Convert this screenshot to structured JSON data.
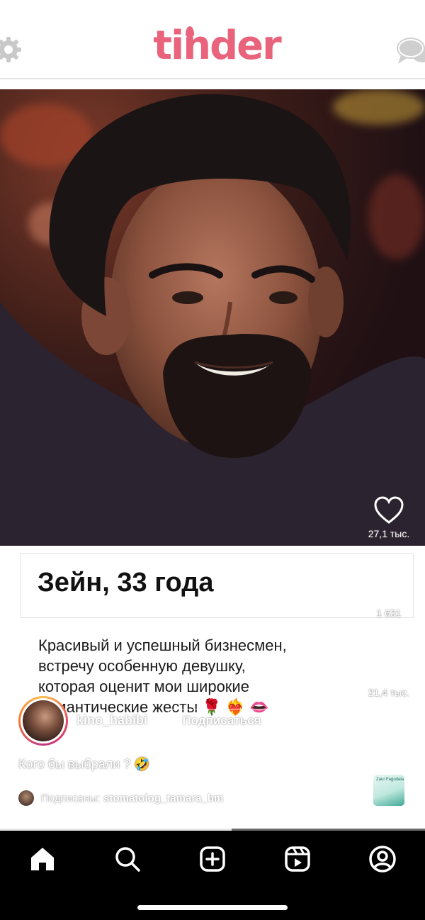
{
  "header": {
    "logo_text": "tinder",
    "brand_color": "#e8637b",
    "left_icon": "gear-icon",
    "right_icon": "chat-bubbles-icon"
  },
  "profile": {
    "name": "Зейн, 33 года",
    "bio_lines": [
      "Красивый и успешный бизнесмен,",
      "встречу особенную девушку,",
      "которая оценит мои широкие",
      "романтические жесты 🌹 ❤️‍🔥 👄"
    ]
  },
  "actions": {
    "like": {
      "icon": "heart-icon",
      "count": "27,1 тыс."
    },
    "comment": {
      "icon": "comment-icon",
      "count": "1 631"
    },
    "share": {
      "icon": "send-icon",
      "count": "21,4 тыс."
    },
    "more": {
      "icon": "more-icon"
    }
  },
  "author": {
    "username": "kino_habibi",
    "follow_label": "Подписаться"
  },
  "caption": "Кого бы выбрали ? 🤣",
  "followed_by": {
    "label": "Подписаны:",
    "account": "stomatolog_tamara_bm"
  },
  "audio_thumb_text": "Zaur Fagodala",
  "progress_fraction": 0.545,
  "nav": [
    {
      "name": "home",
      "icon": "home-icon"
    },
    {
      "name": "search",
      "icon": "search-icon"
    },
    {
      "name": "create",
      "icon": "plus-square-icon"
    },
    {
      "name": "reels",
      "icon": "reels-icon"
    },
    {
      "name": "profile",
      "icon": "profile-icon"
    }
  ]
}
